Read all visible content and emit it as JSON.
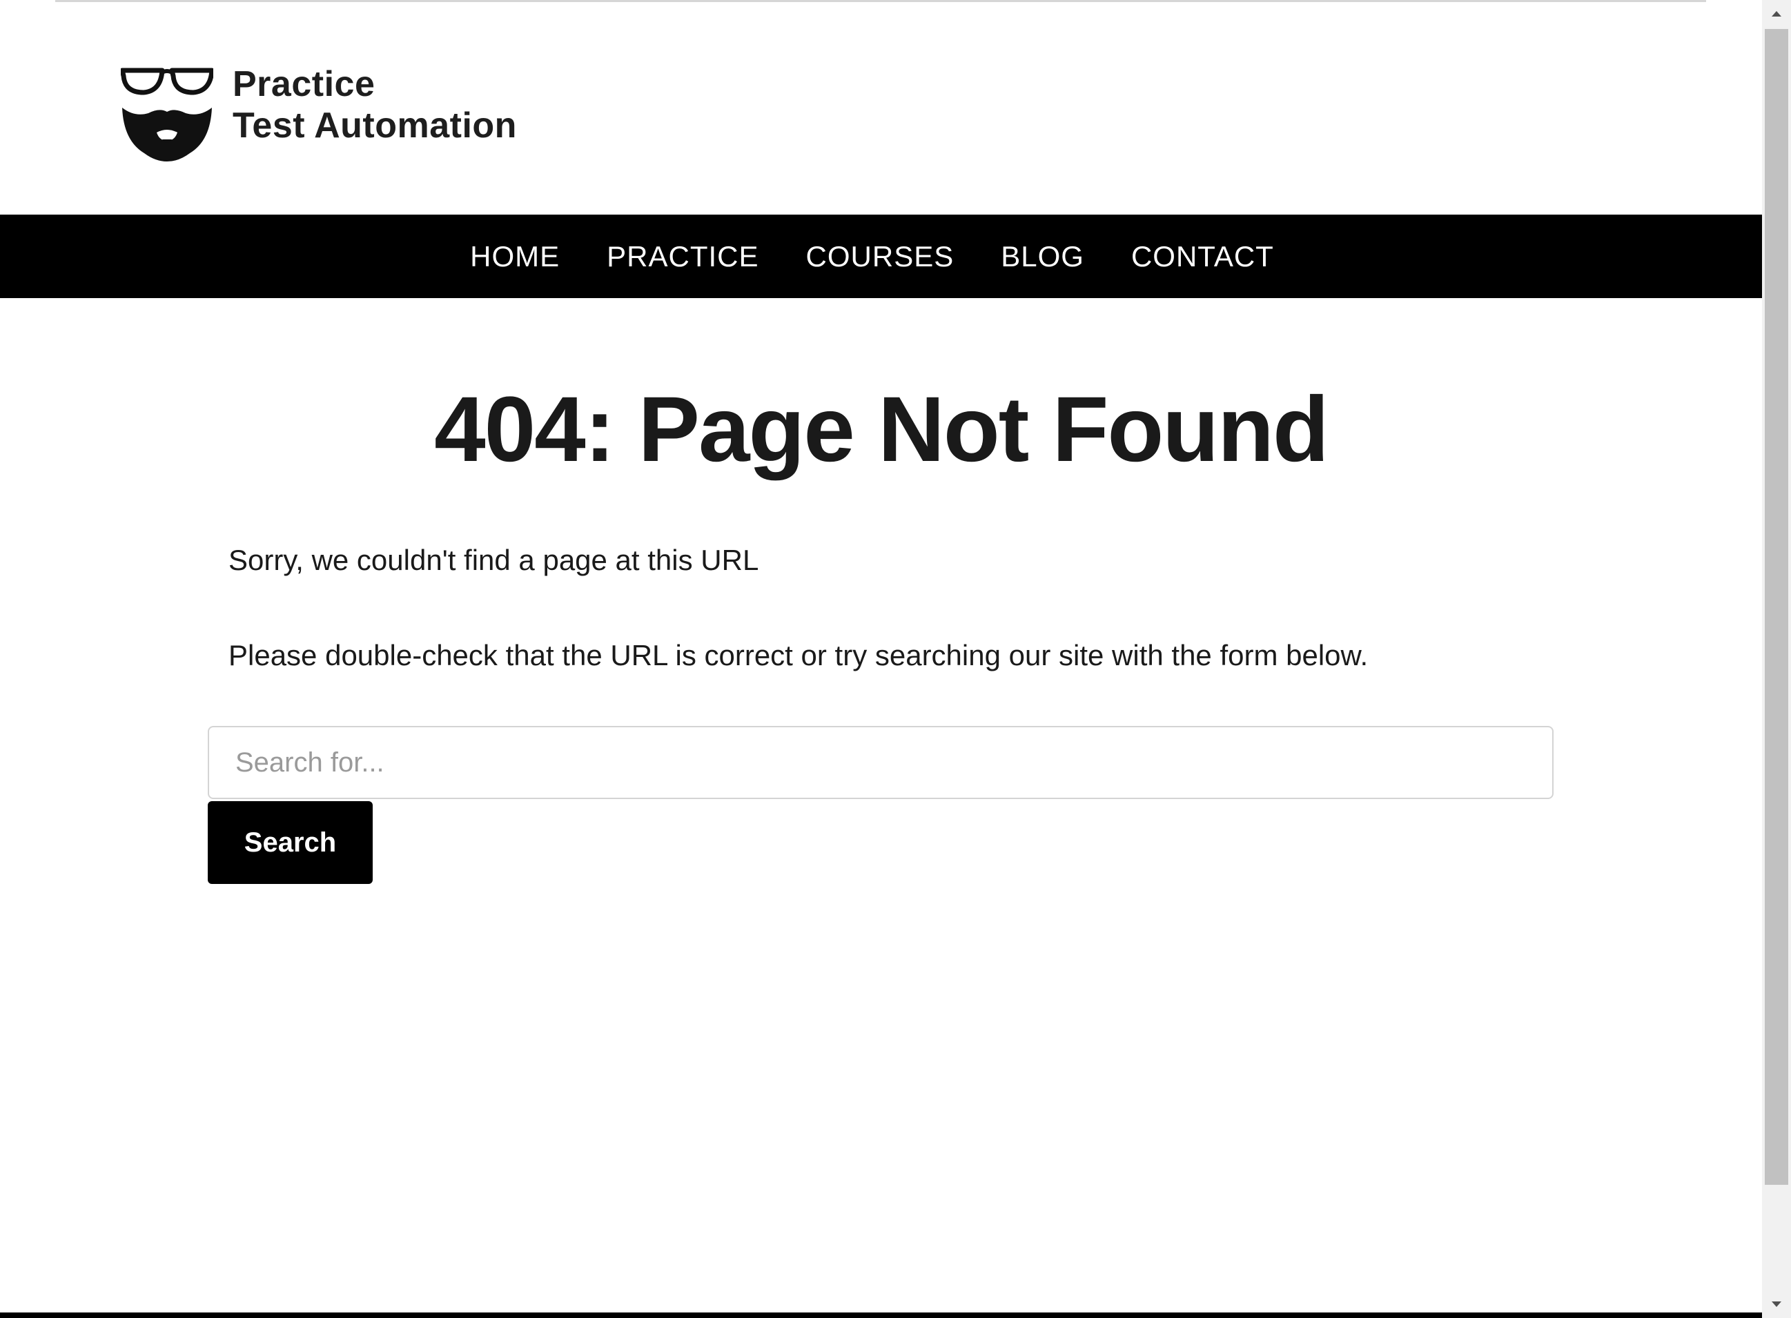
{
  "site": {
    "logo": {
      "icon": "glasses-beard-icon",
      "line1": "Practice",
      "line2": "Test Automation"
    }
  },
  "nav": {
    "items": [
      {
        "label": "HOME"
      },
      {
        "label": "PRACTICE"
      },
      {
        "label": "COURSES"
      },
      {
        "label": "BLOG"
      },
      {
        "label": "CONTACT"
      }
    ]
  },
  "main": {
    "title": "404: Page Not Found",
    "message_1": "Sorry, we couldn't find a page at this URL",
    "message_2": "Please double-check that the URL is correct or try searching our site with the form below.",
    "search": {
      "placeholder": "Search for...",
      "value": "",
      "button_label": "Search"
    }
  },
  "colors": {
    "nav_background": "#000000",
    "nav_text": "#ffffff",
    "button_background": "#000000",
    "heading_text": "#1a1a1a"
  }
}
